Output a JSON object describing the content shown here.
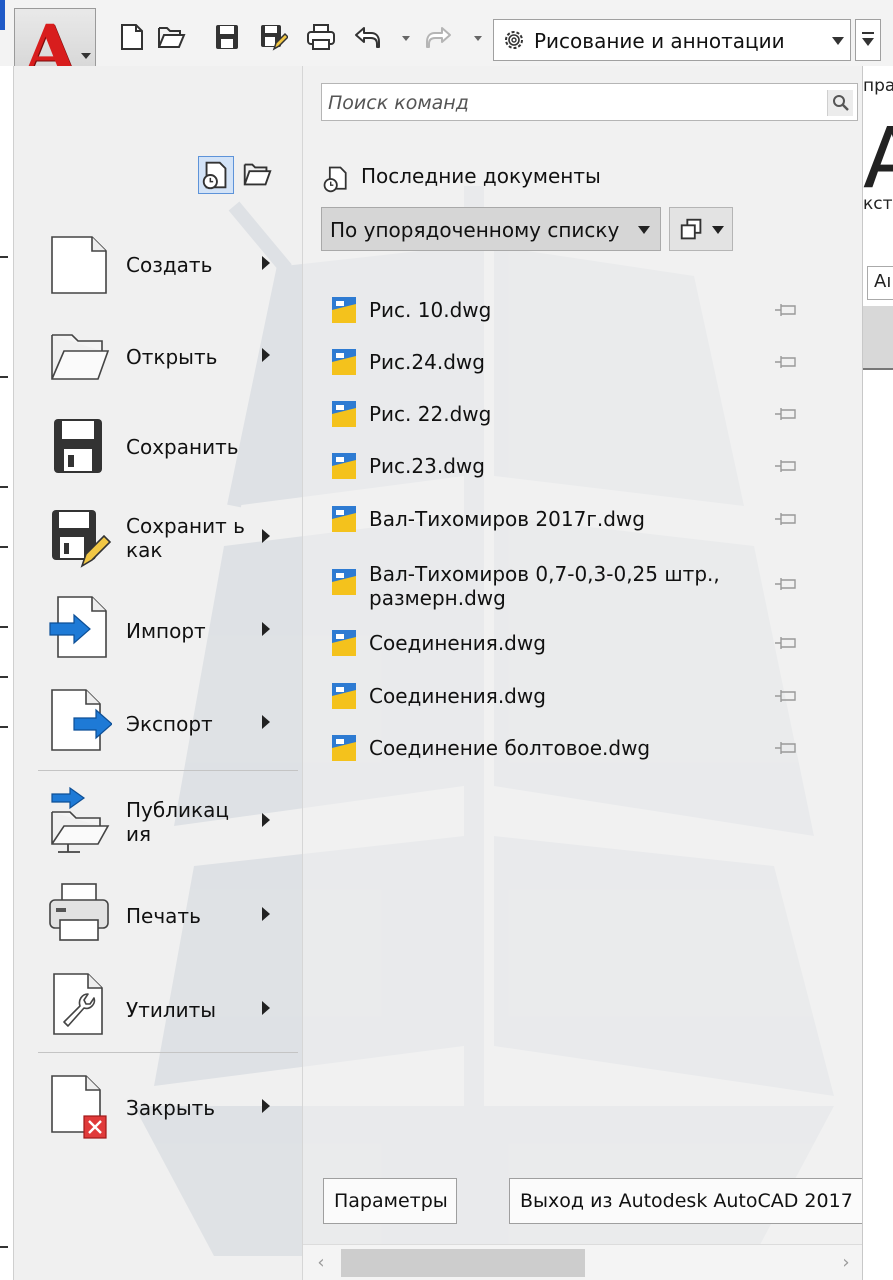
{
  "quick_access": {
    "workspace_label": "Рисование и аннотации"
  },
  "background": {
    "tab_text": "пра",
    "big_letter": "А",
    "small_text": "кст",
    "control_text": "Аı"
  },
  "menu": {
    "search_placeholder": "Поиск команд",
    "commands": [
      {
        "label": "Создать"
      },
      {
        "label": "Открыть"
      },
      {
        "label": "Сохранить"
      },
      {
        "label": "Сохранит ь как"
      },
      {
        "label": "Импорт"
      },
      {
        "label": "Экспорт"
      },
      {
        "label": "Публикац ия"
      },
      {
        "label": "Печать"
      },
      {
        "label": "Утилиты"
      },
      {
        "label": "Закрыть"
      }
    ],
    "recent_header": "Последние документы",
    "sort_label": "По упорядоченному списку",
    "recent_docs": [
      {
        "name": "Рис. 10.dwg"
      },
      {
        "name": "Рис.24.dwg"
      },
      {
        "name": "Рис. 22.dwg"
      },
      {
        "name": "Рис.23.dwg"
      },
      {
        "name": "Вал-Тихомиров 2017г.dwg"
      },
      {
        "name": "Вал-Тихомиров 0,7-0,3-0,25 штр., размерн.dwg"
      },
      {
        "name": "Соединения.dwg"
      },
      {
        "name": "Соединения.dwg"
      },
      {
        "name": "Соединение болтовое.dwg"
      }
    ],
    "options_button": "Параметры",
    "exit_button": "Выход из Autodesk AutoCAD 2017"
  },
  "colors": {
    "brand_red": "#d81d1d",
    "toggle_highlight": "#d3e3f7",
    "arrow_blue": "#1e7ad6"
  }
}
